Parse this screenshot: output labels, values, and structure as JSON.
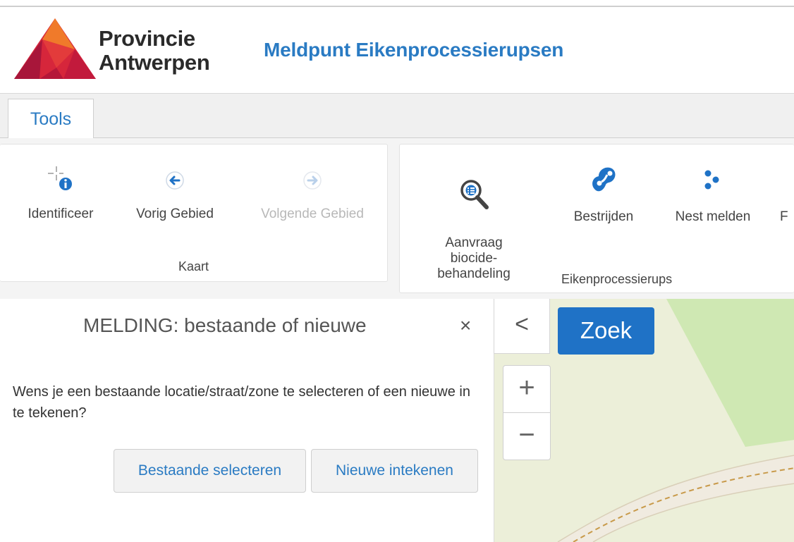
{
  "header": {
    "logo": {
      "line1": "Provincie",
      "line2": "Antwerpen"
    },
    "app_title": "Meldpunt Eikenprocessierupsen"
  },
  "ribbon": {
    "tab": "Tools",
    "groups": [
      {
        "label": "Kaart",
        "tools": [
          {
            "label": "Identificeer",
            "icon": "identify-icon",
            "enabled": true
          },
          {
            "label": "Vorig Gebied",
            "icon": "arrow-left-circle-icon",
            "enabled": true
          },
          {
            "label": "Volgende Gebied",
            "icon": "arrow-right-circle-icon",
            "enabled": false
          }
        ]
      },
      {
        "label": "Eikenprocessierups",
        "tools": [
          {
            "label": "Aanvraag\nbiocide-\nbehandeling",
            "icon": "search-list-icon",
            "enabled": true
          },
          {
            "label": "Bestrijden",
            "icon": "caterpillar-icon",
            "enabled": true
          },
          {
            "label": "Nest melden",
            "icon": "dots-icon",
            "enabled": true
          },
          {
            "label": "F",
            "icon": "",
            "enabled": true
          }
        ]
      }
    ]
  },
  "panel": {
    "title": "MELDING: bestaande of nieuwe",
    "close": "×",
    "message": "Wens je een bestaande locatie/straat/zone te selecteren of een nieuwe in te tekenen?",
    "buttons": {
      "existing": "Bestaande selecteren",
      "new": "Nieuwe intekenen"
    }
  },
  "map": {
    "collapse": "<",
    "search": "Zoek",
    "zoom_in": "+",
    "zoom_out": "−",
    "colors": {
      "base": "#ecefd9",
      "park": "#cfe8b3",
      "path": "#f0ebe0",
      "path_edge": "#d9cfb8",
      "path_dash": "#c89a4a"
    }
  },
  "colors": {
    "accent": "#2a7bc3",
    "search_button": "#1f72c6"
  }
}
